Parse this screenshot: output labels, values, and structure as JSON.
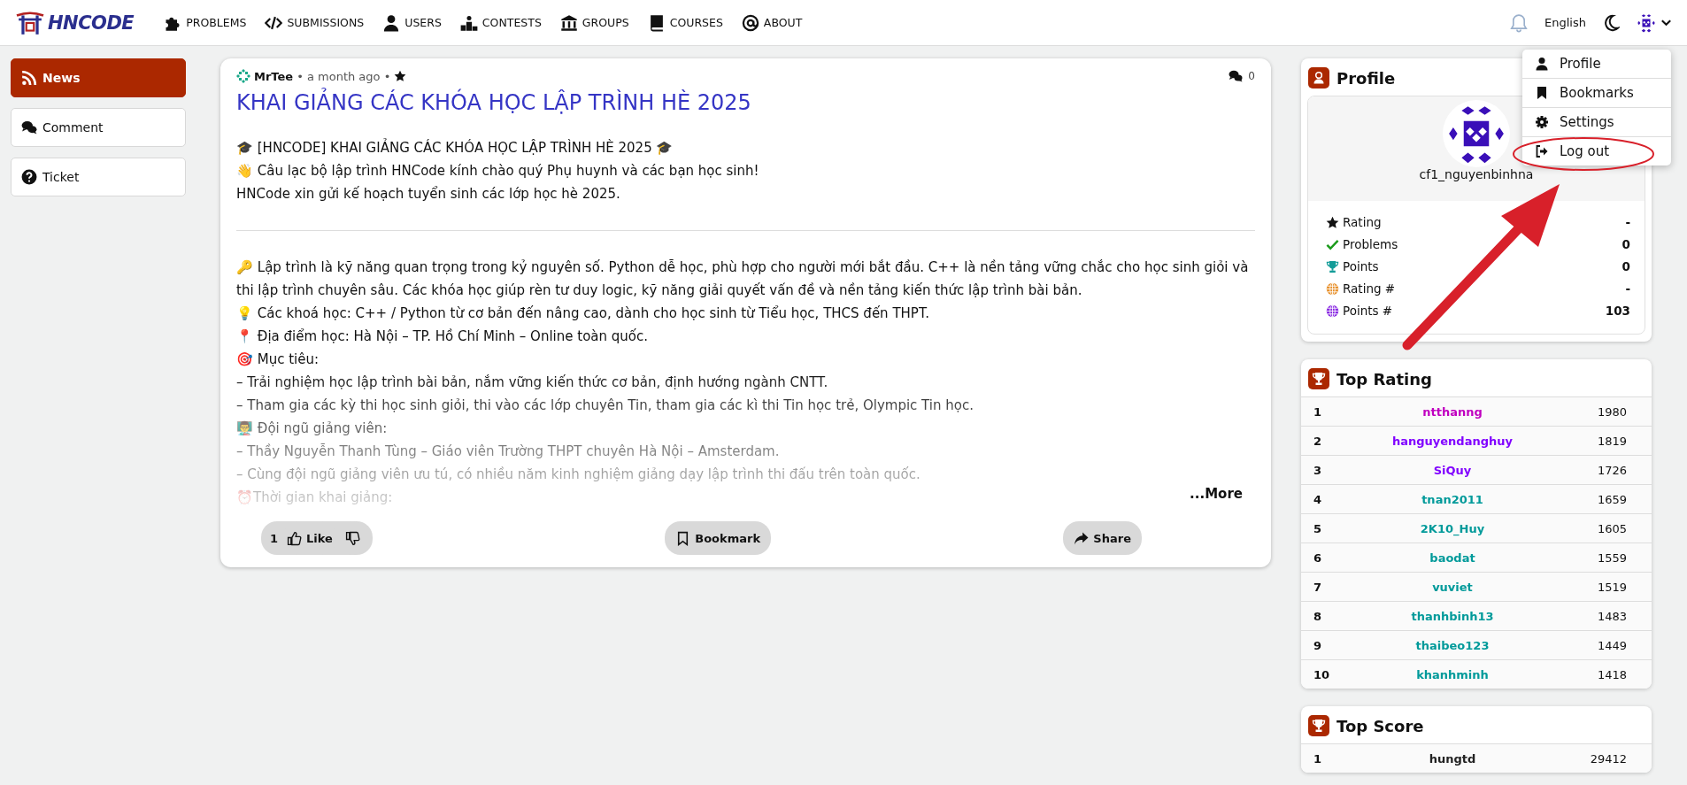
{
  "navbar": {
    "brand": "HNCODE",
    "items": [
      {
        "label": "PROBLEMS",
        "kind": "puzzle"
      },
      {
        "label": "SUBMISSIONS",
        "kind": "code"
      },
      {
        "label": "USERS",
        "kind": "user"
      },
      {
        "label": "CONTESTS",
        "kind": "podium"
      },
      {
        "label": "GROUPS",
        "kind": "building"
      },
      {
        "label": "COURSES",
        "kind": "book"
      },
      {
        "label": "ABOUT",
        "kind": "at"
      }
    ],
    "language": "English"
  },
  "user_menu": [
    {
      "label": "Profile",
      "kind": "user"
    },
    {
      "label": "Bookmarks",
      "kind": "bookmark"
    },
    {
      "label": "Settings",
      "kind": "gear"
    },
    {
      "label": "Log out",
      "kind": "logout"
    }
  ],
  "sidebar": {
    "items": [
      {
        "label": "News",
        "kind": "rss",
        "selected": true
      },
      {
        "label": "Comment",
        "kind": "comments",
        "selected": false
      },
      {
        "label": "Ticket",
        "kind": "question",
        "selected": false
      }
    ]
  },
  "post": {
    "author": "MrTee",
    "time": "• a month ago •",
    "comment_count": "0",
    "title": "KHAI GIẢNG CÁC KHÓA HỌC LẬP TRÌNH HÈ 2025",
    "intro": [
      "🎓 [HNCODE] KHAI GIẢNG CÁC KHÓA HỌC LẬP TRÌNH HÈ 2025 🎓",
      "👋 Câu lạc bộ lập trình HNCode kính chào quý Phụ huynh và các bạn học sinh!",
      "HNCode xin gửi kế hoạch tuyển sinh các lớp học hè 2025."
    ],
    "body": [
      "🔑 Lập trình là kỹ năng quan trọng trong kỷ nguyên số. Python dễ học, phù hợp cho người mới bắt đầu. C++ là nền tảng vững chắc cho học sinh giỏi và thi lập trình chuyên sâu. Các khóa học giúp rèn tư duy logic, kỹ năng giải quyết vấn đề và nền tảng kiến thức lập trình bài bản.",
      "💡 Các khoá học: C++ / Python từ cơ bản đến nâng cao, dành cho học sinh từ Tiểu học, THCS đến THPT.",
      "📍 Địa điểm học: Hà Nội – TP. Hồ Chí Minh – Online toàn quốc.",
      "🎯 Mục tiêu:",
      "– Trải nghiệm học lập trình bài bản, nắm vững kiến thức cơ bản, định hướng ngành CNTT.",
      "– Tham gia các kỳ thi học sinh giỏi, thi vào các lớp chuyên Tin, tham gia các kì thi Tin học trẻ, Olympic Tin học.",
      "👨‍🏫 Đội ngũ giảng viên:",
      "– Thầy Nguyễn Thanh Tùng – Giáo viên Trường THPT chuyên Hà Nội – Amsterdam.",
      "– Cùng đội ngũ giảng viên ưu tú, có nhiều năm kinh nghiệm giảng dạy lập trình thi đấu trên toàn quốc.",
      "⏰Thời gian khai giảng:"
    ],
    "more": "...More",
    "like_count": "1",
    "like": "Like",
    "bookmark": "Bookmark",
    "share": "Share"
  },
  "profile": {
    "title": "Profile",
    "username": "cf1_nguyenbinhna",
    "stats": [
      {
        "label": "Rating",
        "kind": "star",
        "value": "-"
      },
      {
        "label": "Problems",
        "kind": "check",
        "value": "0"
      },
      {
        "label": "Points",
        "kind": "trophy",
        "value": "0"
      },
      {
        "label": "Rating #",
        "kind": "globe-orange",
        "value": "-"
      },
      {
        "label": "Points #",
        "kind": "globe-purple",
        "value": "103"
      }
    ]
  },
  "top_rating": {
    "title": "Top Rating",
    "rows": [
      {
        "rank": "1",
        "user": "ntthanng",
        "score": "1980",
        "color": "#c000c0"
      },
      {
        "rank": "2",
        "user": "hanguyendanghuy",
        "score": "1819",
        "color": "#8000ff"
      },
      {
        "rank": "3",
        "user": "SiQuy",
        "score": "1726",
        "color": "#8000ff"
      },
      {
        "rank": "4",
        "user": "tnan2011",
        "score": "1659",
        "color": "#009a9a"
      },
      {
        "rank": "5",
        "user": "2K10_Huy",
        "score": "1605",
        "color": "#009a9a"
      },
      {
        "rank": "6",
        "user": "baodat",
        "score": "1559",
        "color": "#009a9a"
      },
      {
        "rank": "7",
        "user": "vuviet",
        "score": "1519",
        "color": "#009a9a"
      },
      {
        "rank": "8",
        "user": "thanhbinh13",
        "score": "1483",
        "color": "#009a9a"
      },
      {
        "rank": "9",
        "user": "thaibeo123",
        "score": "1449",
        "color": "#009a9a"
      },
      {
        "rank": "10",
        "user": "khanhminh",
        "score": "1418",
        "color": "#009a9a"
      }
    ]
  },
  "top_score": {
    "title": "Top Score",
    "rows": [
      {
        "rank": "1",
        "user": "hungtd",
        "score": "29412",
        "color": "#222222"
      }
    ]
  }
}
